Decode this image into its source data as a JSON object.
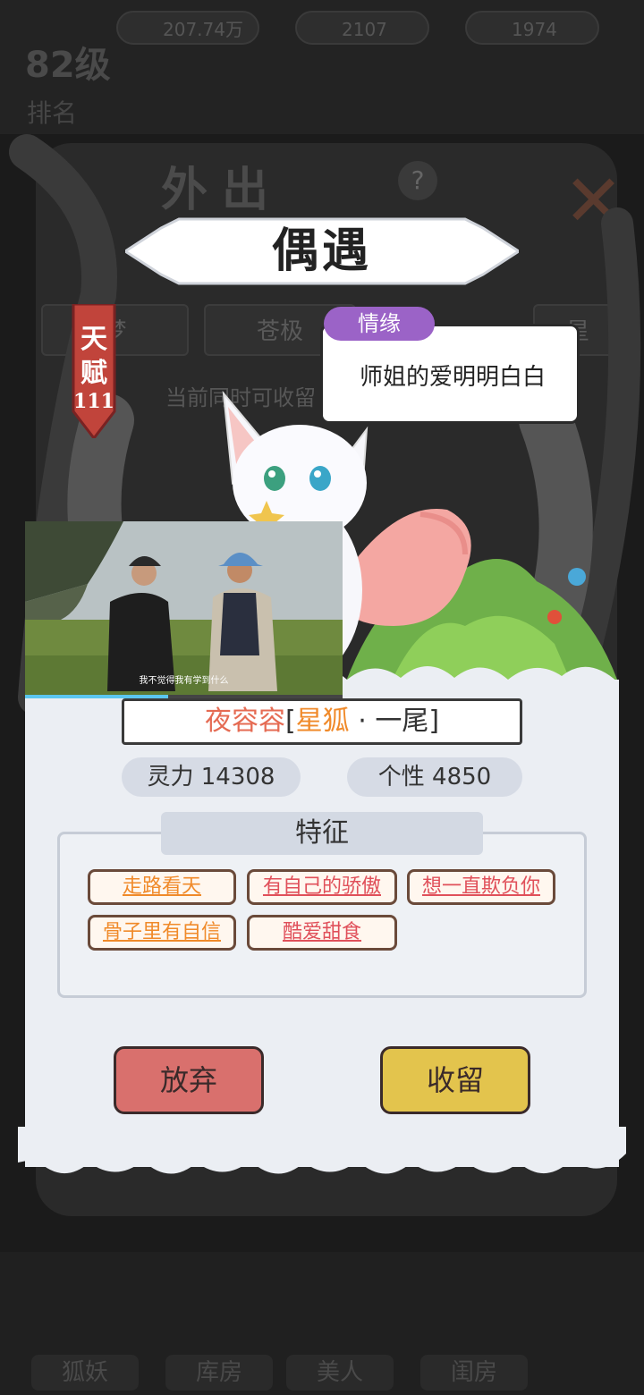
{
  "background": {
    "currency_1": "207.74万",
    "currency_2": "2107",
    "currency_3": "1974",
    "level": "82级",
    "ranking": "排名",
    "screen_title": "外出",
    "tabs": [
      "梦",
      "苍极",
      "星"
    ],
    "hint": "当前同时可收留",
    "nav": [
      "狐妖",
      "库房",
      "美人",
      "闺房"
    ]
  },
  "dialog": {
    "title": "偶遇",
    "talent": {
      "line1": "天",
      "line2": "赋",
      "value": "111"
    },
    "bubble_tag": "情缘",
    "bubble_text": "师姐的爱明明白白",
    "name": "夜容容",
    "bracket_open": "[",
    "species": "星狐",
    "separator": "·",
    "tail": "一尾",
    "bracket_close": "]",
    "stats": [
      {
        "label": "灵力 14308"
      },
      {
        "label": "个性 4850"
      }
    ],
    "features_title": "特征",
    "features": [
      {
        "label": "走路看天",
        "color": "#f08a2a"
      },
      {
        "label": "有自己的骄傲",
        "color": "#e0505a"
      },
      {
        "label": "想一直欺负你",
        "color": "#e0505a"
      },
      {
        "label": "骨子里有自信",
        "color": "#f08a2a"
      },
      {
        "label": "酷爱甜食",
        "color": "#e0505a"
      }
    ],
    "abandon_button": "放弃",
    "keep_button": "收留"
  },
  "video": {
    "subtitle": "我不觉得我有学到什么",
    "progress": 0.45
  }
}
